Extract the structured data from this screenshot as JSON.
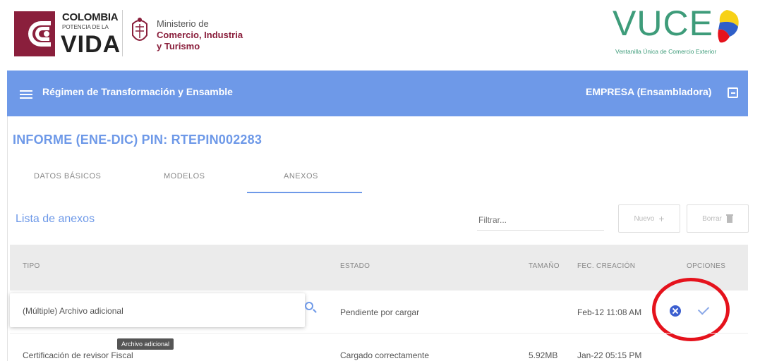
{
  "header": {
    "colombia_top": "COLOMBIA",
    "colombia_sub": "POTENCIA DE LA",
    "colombia_vida": "VIDA",
    "ministry_line1": "Ministerio de",
    "ministry_line2": "Comercio, Industria",
    "ministry_line3": "y Turismo",
    "vuce_title": "VUCE",
    "vuce_subtitle": "Ventanilla Única de Comercio Exterior"
  },
  "topbar": {
    "menu_icon": "hamburger-menu-icon",
    "title": "Régimen de Transformación y Ensamble",
    "company": "EMPRESA (Ensambladora)",
    "logout_icon": "logout-icon",
    "color": "#6e99e8"
  },
  "page": {
    "title": "INFORME (ENE-DIC) PIN: RTEPIN002283"
  },
  "tabs": [
    {
      "label": "DATOS BÁSICOS",
      "active": false
    },
    {
      "label": "MODELOS",
      "active": false
    },
    {
      "label": "ANEXOS",
      "active": true
    }
  ],
  "list": {
    "title": "Lista de anexos",
    "filter_placeholder": "Filtrar...",
    "new_button": "Nuevo",
    "delete_button": "Borrar"
  },
  "table": {
    "headers": [
      "TIPO",
      "ESTADO",
      "TAMAÑO",
      "FEC. CREACIÓN",
      "OPCIONES"
    ],
    "rows": [
      {
        "tipo": "(Múltiple) Archivo adicional",
        "estado": "Pendiente por cargar",
        "tamano": "",
        "fecha": "Feb-12 11:08 AM"
      },
      {
        "tipo": "Certificación de revisor Fiscal",
        "estado": "Cargado correctamente",
        "tamano": "5.92MB",
        "fecha": "Jan-22 05:15 PM"
      }
    ],
    "tooltip": "Archivo adicional"
  },
  "colors": {
    "accent": "#6e99e8",
    "brand_maroon": "#8a1f3c",
    "vuce_green": "#3e9c7a",
    "highlight_red": "#e5121c"
  }
}
